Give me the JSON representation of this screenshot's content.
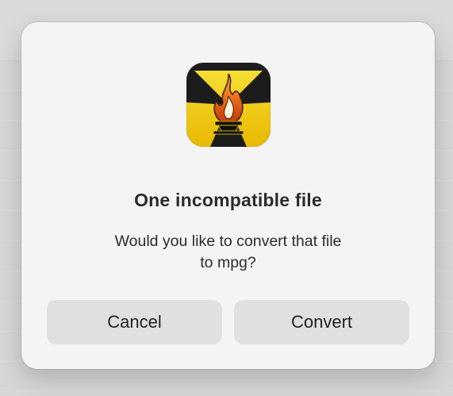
{
  "dialog": {
    "title": "One incompatible file",
    "message_line1": "Would you like to convert that file",
    "message_line2": "to mpg?",
    "cancel_label": "Cancel",
    "convert_label": "Convert"
  },
  "icons": {
    "app_icon": "flame-app-icon"
  },
  "colors": {
    "dialog_bg": "#f4f4f4",
    "button_bg": "#e0e0e0",
    "icon_yellow": "#f2d100",
    "icon_black": "#1c1c1c",
    "flame_orange": "#f06a1c"
  }
}
